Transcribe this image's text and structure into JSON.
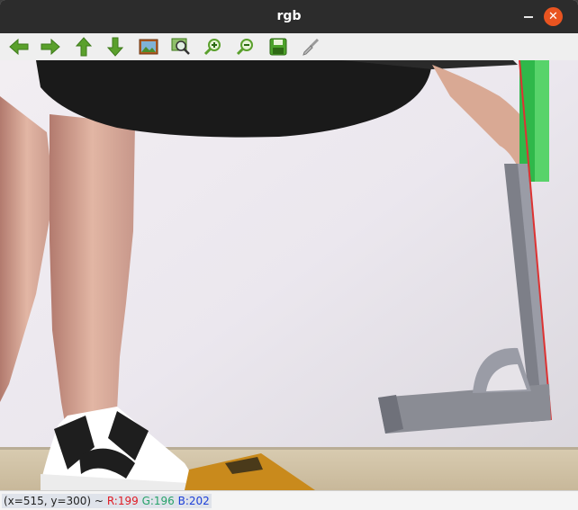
{
  "window": {
    "title": "rgb"
  },
  "titlebar": {
    "close_glyph": "✕"
  },
  "toolbar": {
    "buttons": [
      {
        "name": "pan-left-button",
        "icon": "arrow-left-icon"
      },
      {
        "name": "pan-right-button",
        "icon": "arrow-right-icon"
      },
      {
        "name": "pan-up-button",
        "icon": "arrow-up-icon"
      },
      {
        "name": "pan-down-button",
        "icon": "arrow-down-icon"
      },
      {
        "name": "zoom-fit-button",
        "icon": "image-icon"
      },
      {
        "name": "zoom-area-button",
        "icon": "zoom-area-icon"
      },
      {
        "name": "zoom-in-button",
        "icon": "zoom-in-icon"
      },
      {
        "name": "zoom-out-button",
        "icon": "zoom-out-icon"
      },
      {
        "name": "save-button",
        "icon": "floppy-disk-icon"
      },
      {
        "name": "properties-button",
        "icon": "brush-icon"
      }
    ]
  },
  "status": {
    "coords": "(x=515, y=300) ~",
    "r": "R:199",
    "g": "G:196",
    "b": "B:202"
  },
  "colors": {
    "toolbar_green": "#5aa02c",
    "close_orange": "#e95420",
    "r_color": "#e01b24",
    "g_color": "#26a269",
    "b_color": "#1c3fd8"
  }
}
